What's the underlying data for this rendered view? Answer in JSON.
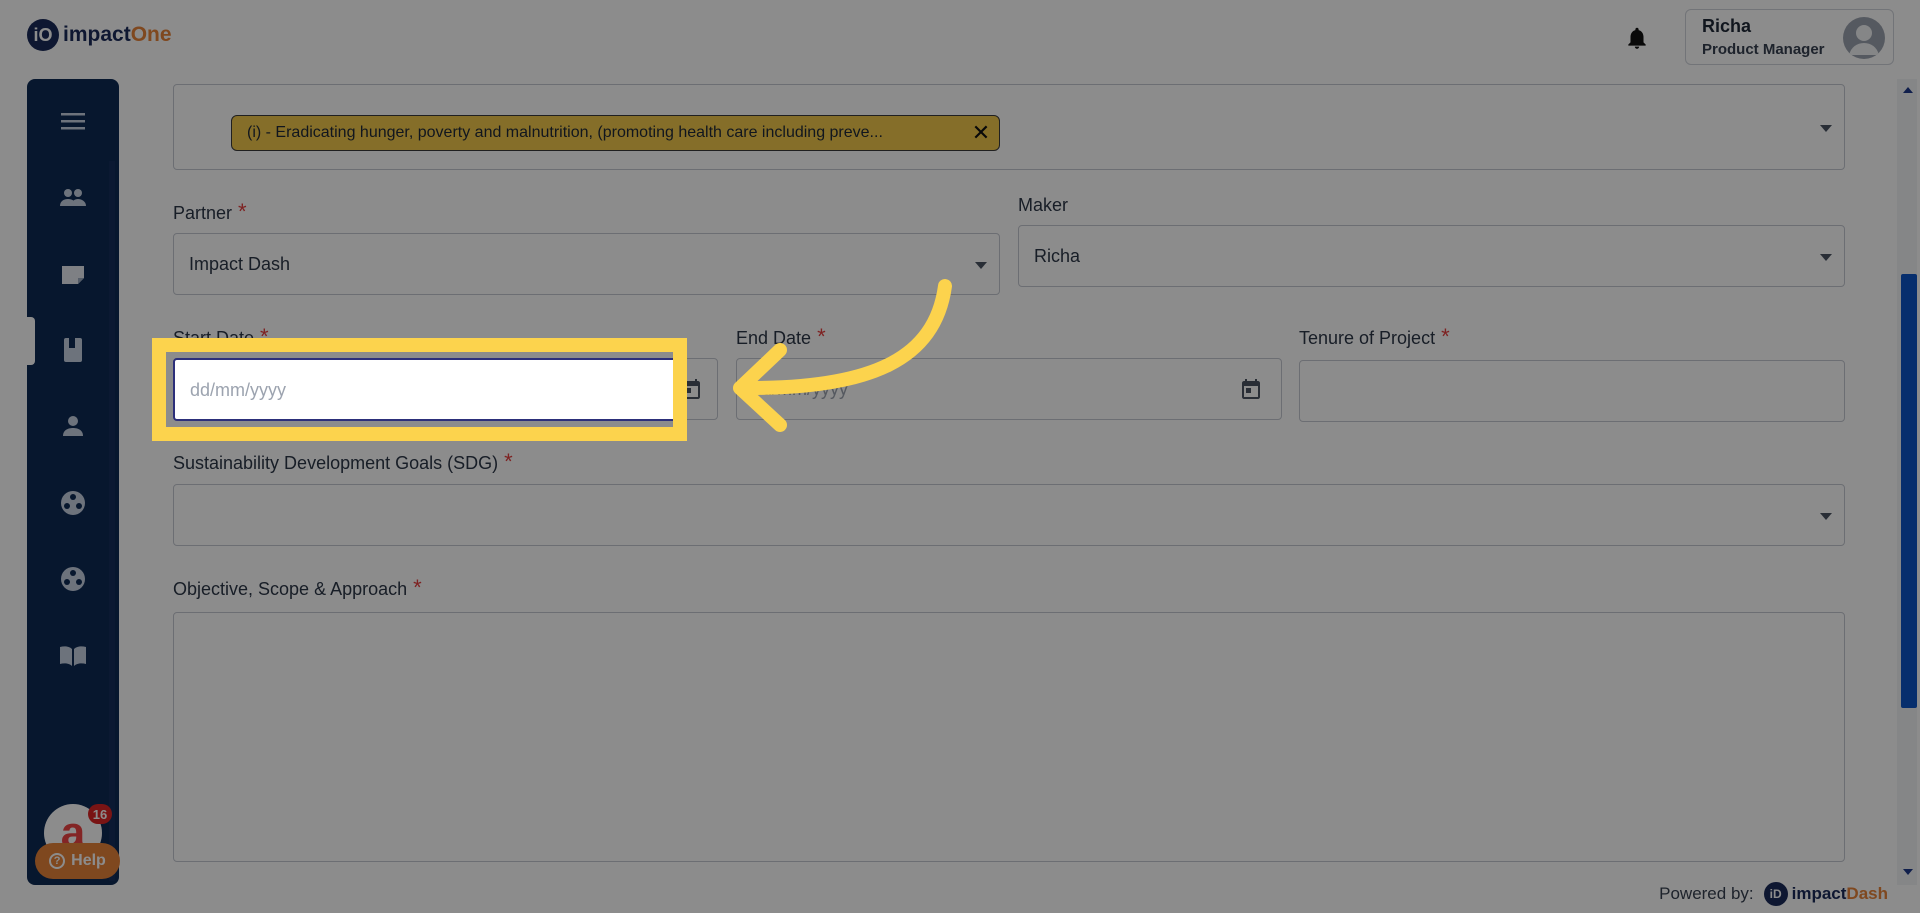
{
  "header": {
    "logo_badge": "iO",
    "logo_main": "impact",
    "logo_accent": "One",
    "user_name": "Richa",
    "user_role": "Product Manager"
  },
  "sidebar": {
    "items": [
      "menu-icon",
      "users-icon",
      "projects-icon",
      "book-icon",
      "profile-icon",
      "group-icon",
      "group-icon-2",
      "library-icon"
    ],
    "notification_count": "16",
    "help_label": "Help"
  },
  "form": {
    "chip_text": "(i) - Eradicating hunger, poverty and malnutrition, (promoting health care including preve...",
    "partner_label": "Partner",
    "partner_value": "Impact Dash",
    "maker_label": "Maker",
    "maker_value": "Richa",
    "start_date_label": "Start Date",
    "start_date_placeholder": "dd/mm/yyyy",
    "end_date_label": "End Date",
    "end_date_placeholder": "dd/mm/yyyy",
    "tenure_label": "Tenure of Project",
    "sdg_label": "Sustainability Development Goals (SDG)",
    "objective_label": "Objective, Scope & Approach",
    "required_mark": "*"
  },
  "footer": {
    "powered_by": "Powered by:",
    "brand_badge": "iD",
    "brand_main": "impact",
    "brand_accent": "Dash"
  },
  "colors": {
    "sidebar_bg": "#0d2a55",
    "accent_orange": "#e8833a",
    "highlight_yellow": "#fcd34d",
    "chip_bg": "#f2c94c",
    "required_red": "#e53e3e"
  }
}
